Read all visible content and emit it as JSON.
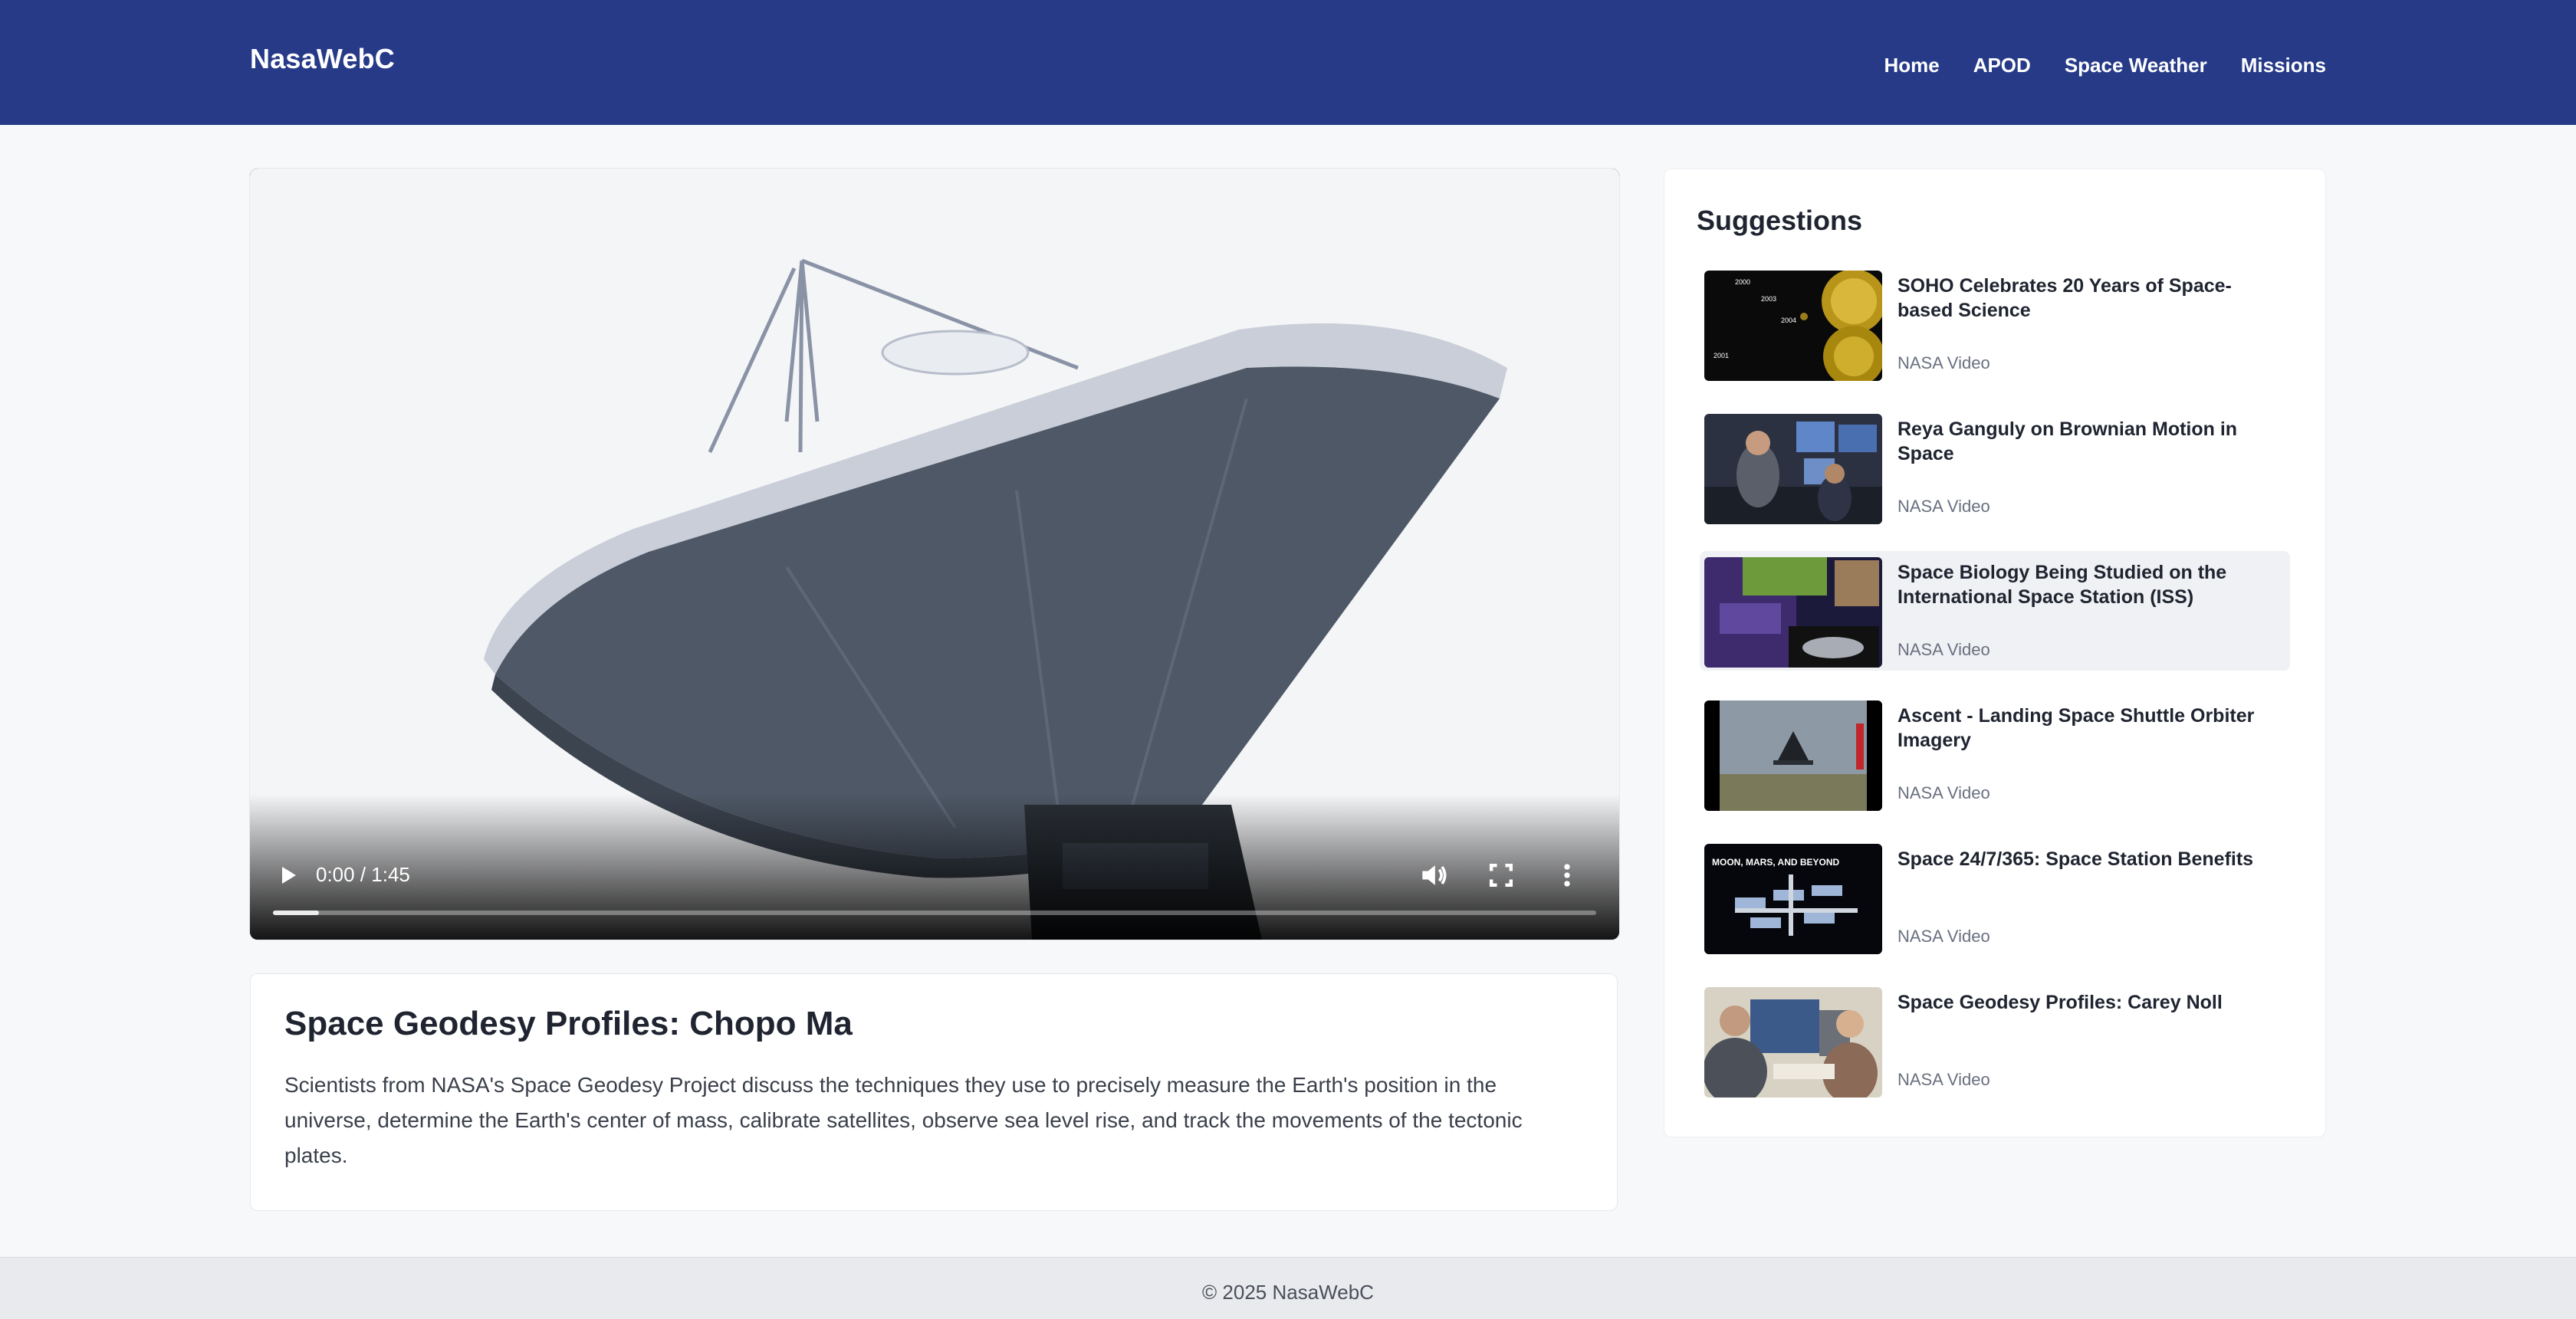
{
  "header": {
    "brand": "NasaWebC",
    "nav": [
      "Home",
      "APOD",
      "Space Weather",
      "Missions"
    ]
  },
  "video": {
    "time": "0:00 / 1:45",
    "progress_fraction": 0.035,
    "icons": [
      "play-icon",
      "volume-icon",
      "fullscreen-icon",
      "more-options-icon"
    ]
  },
  "info": {
    "title": "Space Geodesy Profiles: Chopo Ma",
    "description": "Scientists from NASA's Space Geodesy Project discuss the techniques they use to precisely measure the Earth's position in the universe, determine the Earth's center of mass, calibrate satellites, observe sea level rise, and track the movements of the tectonic plates."
  },
  "suggestions": {
    "heading": "Suggestions",
    "items": [
      {
        "title": "SOHO Celebrates 20 Years of Space-based Science",
        "source": "NASA Video"
      },
      {
        "title": "Reya Ganguly on Brownian Motion in Space",
        "source": "NASA Video"
      },
      {
        "title": "Space Biology Being Studied on the International Space Station (ISS)",
        "source": "NASA Video"
      },
      {
        "title": "Ascent - Landing Space Shuttle Orbiter Imagery",
        "source": "NASA Video"
      },
      {
        "title": "Space 24/7/365: Space Station Benefits",
        "source": "NASA Video"
      },
      {
        "title": "Space Geodesy Profiles: Carey Noll",
        "source": "NASA Video"
      }
    ]
  },
  "thumb_text": {
    "soho_years": [
      "2000",
      "2001",
      "2004",
      "2003"
    ],
    "station_caption": "MOON, MARS, AND BEYOND"
  },
  "footer": {
    "text": "© 2025 NasaWebC"
  }
}
